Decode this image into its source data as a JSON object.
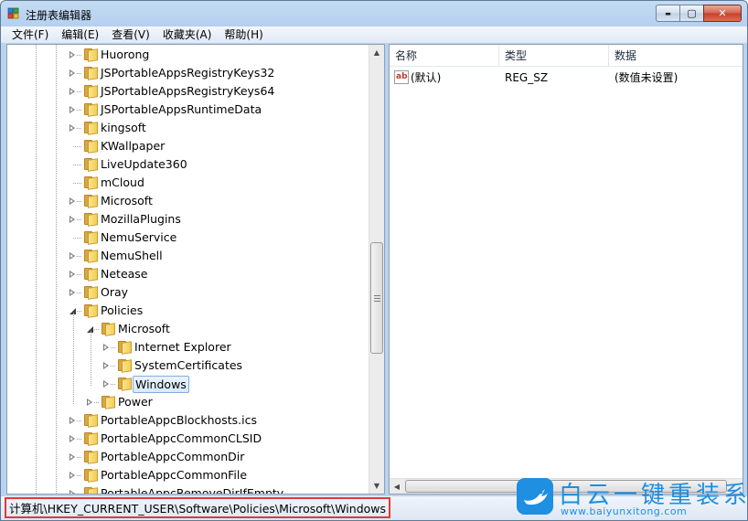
{
  "window": {
    "title": "注册表编辑器",
    "caption_buttons": {
      "minimize": "▬",
      "maximize": "▢",
      "close": "✕"
    }
  },
  "menu": [
    {
      "label": "文件(F)"
    },
    {
      "label": "编辑(E)"
    },
    {
      "label": "查看(V)"
    },
    {
      "label": "收藏夹(A)"
    },
    {
      "label": "帮助(H)"
    }
  ],
  "tree": {
    "nodes": [
      {
        "label": "Huorong",
        "depth": 0,
        "expander": "collapsed"
      },
      {
        "label": "JSPortableAppsRegistryKeys32",
        "depth": 0,
        "expander": "collapsed"
      },
      {
        "label": "JSPortableAppsRegistryKeys64",
        "depth": 0,
        "expander": "collapsed"
      },
      {
        "label": "JSPortableAppsRuntimeData",
        "depth": 0,
        "expander": "collapsed"
      },
      {
        "label": "kingsoft",
        "depth": 0,
        "expander": "collapsed"
      },
      {
        "label": "KWallpaper",
        "depth": 0,
        "expander": "none"
      },
      {
        "label": "LiveUpdate360",
        "depth": 0,
        "expander": "none"
      },
      {
        "label": "mCloud",
        "depth": 0,
        "expander": "none"
      },
      {
        "label": "Microsoft",
        "depth": 0,
        "expander": "collapsed"
      },
      {
        "label": "MozillaPlugins",
        "depth": 0,
        "expander": "collapsed"
      },
      {
        "label": "NemuService",
        "depth": 0,
        "expander": "none"
      },
      {
        "label": "NemuShell",
        "depth": 0,
        "expander": "collapsed"
      },
      {
        "label": "Netease",
        "depth": 0,
        "expander": "collapsed"
      },
      {
        "label": "Oray",
        "depth": 0,
        "expander": "collapsed"
      },
      {
        "label": "Policies",
        "depth": 0,
        "expander": "expanded"
      },
      {
        "label": "Microsoft",
        "depth": 1,
        "expander": "expanded"
      },
      {
        "label": "Internet Explorer",
        "depth": 2,
        "expander": "collapsed"
      },
      {
        "label": "SystemCertificates",
        "depth": 2,
        "expander": "collapsed"
      },
      {
        "label": "Windows",
        "depth": 2,
        "expander": "collapsed",
        "selected": true
      },
      {
        "label": "Power",
        "depth": 1,
        "expander": "collapsed"
      },
      {
        "label": "PortableAppcBlockhosts.ics",
        "depth": 0,
        "expander": "collapsed"
      },
      {
        "label": "PortableAppcCommonCLSID",
        "depth": 0,
        "expander": "collapsed"
      },
      {
        "label": "PortableAppcCommonDir",
        "depth": 0,
        "expander": "collapsed"
      },
      {
        "label": "PortableAppcCommonFile",
        "depth": 0,
        "expander": "collapsed"
      },
      {
        "label": "PortableAppcRemoveDirIfEmpty",
        "depth": 0,
        "expander": "collapsed"
      }
    ]
  },
  "list": {
    "columns": [
      {
        "label": "名称"
      },
      {
        "label": "类型"
      },
      {
        "label": "数据"
      }
    ],
    "rows": [
      {
        "icon": "ab",
        "name": "(默认)",
        "type": "REG_SZ",
        "data": "(数值未设置)"
      }
    ]
  },
  "status": {
    "path": "计算机\\HKEY_CURRENT_USER\\Software\\Policies\\Microsoft\\Windows"
  },
  "watermark": {
    "title": "白云一键重装系统",
    "url": "www.baiyunxitong.com"
  },
  "colors": {
    "selection_border": "#84acdd",
    "status_highlight": "#e03a3a",
    "watermark_blue": "#1e8fe1"
  }
}
